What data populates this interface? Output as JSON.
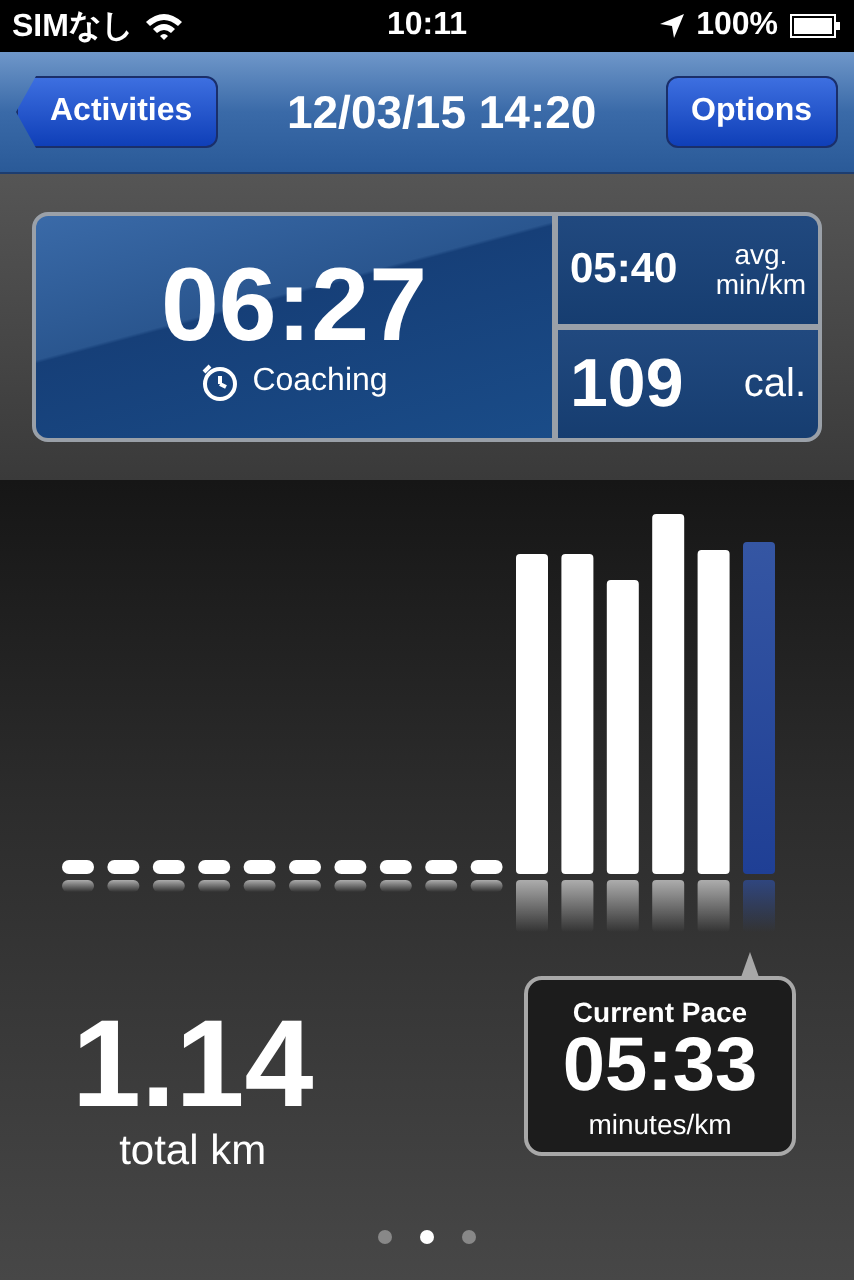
{
  "status_bar": {
    "carrier": "SIMなし",
    "time": "10:11",
    "battery": "100%"
  },
  "nav_bar": {
    "back_button": "Activities",
    "title": "12/03/15 14:20",
    "options_button": "Options"
  },
  "summary": {
    "duration": "06:27",
    "coaching": "Coaching",
    "avg_pace": "05:40",
    "avg_label": "avg.",
    "avg_unit": "min/km",
    "calories": "109",
    "calories_unit": "cal."
  },
  "distance": {
    "value": "1.14",
    "unit": "total km"
  },
  "current_pace": {
    "title": "Current Pace",
    "value": "05:33",
    "unit": "minutes/km"
  },
  "page_dots": [
    {
      "selected": false
    },
    {
      "selected": true
    },
    {
      "selected": false
    }
  ]
}
